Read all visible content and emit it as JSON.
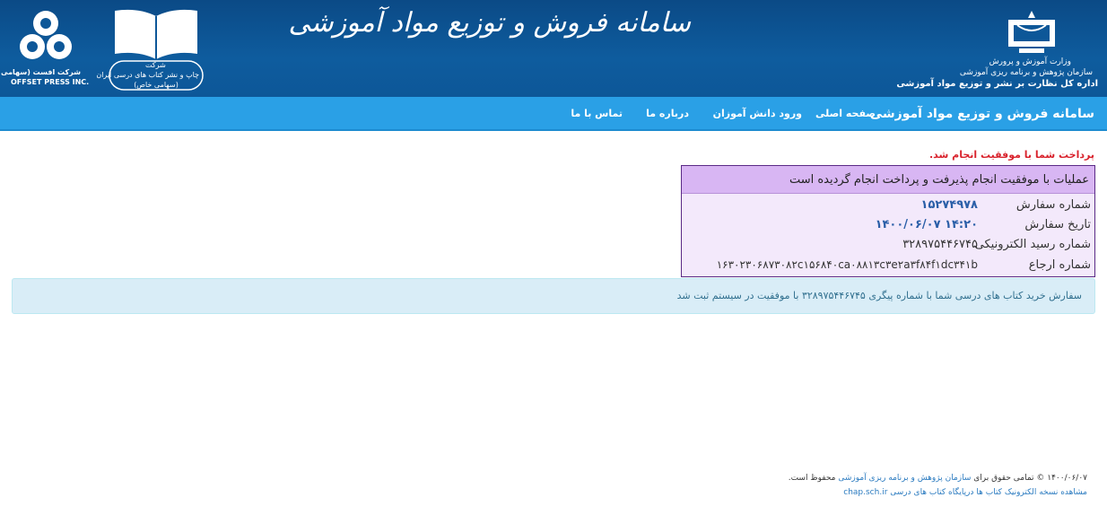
{
  "header": {
    "title": "سامانه فروش و توزیع مواد آموزشی",
    "ministry_lines": [
      "وزارت آموزش و پرورش",
      "سازمان پژوهش و برنامه ریزی آموزشی",
      "اداره کل نظارت بر نشر و توزیع مواد آموزشی"
    ],
    "publisher_lines": [
      "شرکت",
      "چاپ و نشر کتاب های درسی ایران",
      "(سهامی خاص)"
    ],
    "offset_lines": [
      "شرکت افست (سهامی عام)",
      "OFFSET PRESS INC."
    ]
  },
  "nav": {
    "brand": "سامانه فروش و توزیع مواد آموزشی",
    "items": [
      "صفحه اصلی",
      "ورود دانش آموزان",
      "درباره ما",
      "تماس با ما"
    ]
  },
  "payment": {
    "success_message": "پرداخت شما با موفقیت انجام شد.",
    "box_title": "عملیات با موفقیت انجام پذیرفت و پرداخت انجام گردیده است",
    "rows": [
      {
        "label": "شماره سفارش",
        "value": "۱۵۲۷۴۹۷۸"
      },
      {
        "label": "تاریخ سفارش",
        "value": "۱۴۰۰/۰۶/۰۷ ۱۴:۲۰"
      },
      {
        "label": "شماره رسید الکترونیکی",
        "value": "۳۲۸۹۷۵۴۴۶۷۴۵"
      },
      {
        "label": "شماره ارجاع",
        "value": "۱۶۳۰۲۳۰۶۸۷۳۰۸۲c۱۵۶۸۴۰ca۰۸۸۱۳c۳e۲a۳f۸۴f۱dc۳۴۱b"
      }
    ]
  },
  "alert": {
    "text": "سفارش خرید کتاب های درسی شما با شماره پیگری ۳۲۸۹۷۵۴۴۶۷۴۵ با موفقیت در سیستم ثبت شد"
  },
  "footer": {
    "copyright_prefix": "۱۴۰۰/۰۶/۰۷ © تمامی حقوق برای ",
    "copyright_org": "سازمان پژوهش و برنامه ریزی آموزشی",
    "copyright_suffix": " محفوظ است.",
    "ebook_text": "مشاهده نسخه الکترونیک کتاب ها درپایگاه کتاب های درسی ",
    "ebook_link": "chap.sch.ir"
  },
  "colors": {
    "header_bg": "#0d5798",
    "nav_bg": "#2aa0e6",
    "success_red": "#d9232d",
    "receipt_head_bg": "#d8b6f3",
    "alert_bg": "#d9edf7"
  }
}
